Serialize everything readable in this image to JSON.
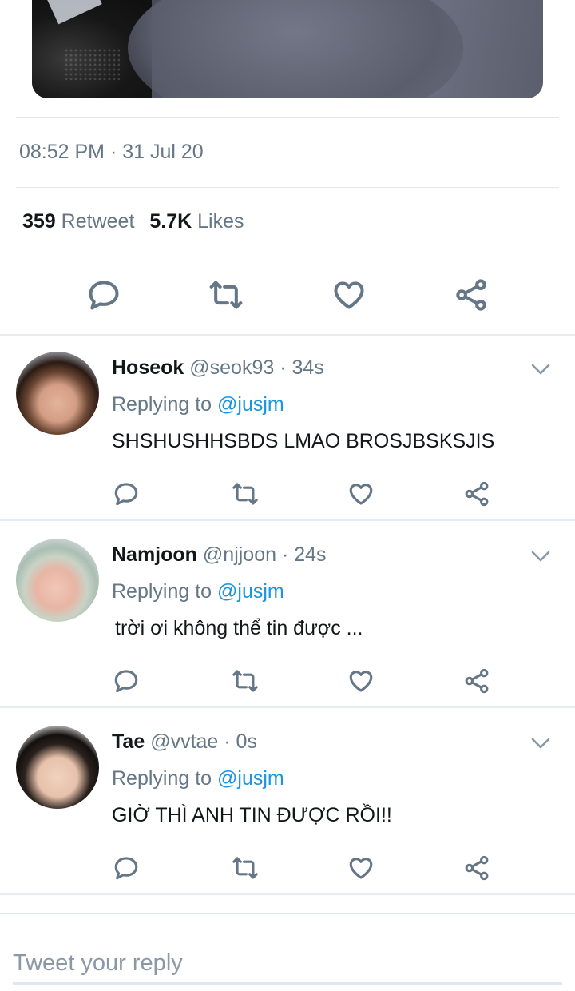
{
  "tweet": {
    "timestamp": "08:52 PM · 31 Jul 20",
    "retweet_count": "359",
    "retweet_label": "Retweet",
    "likes_count": "5.7K",
    "likes_label": "Likes"
  },
  "replies": [
    {
      "name": "Hoseok",
      "handle_time": "@seok93 · 34s",
      "replying_prefix": "Replying to",
      "mention": "@jusjm",
      "text": "SHSHUSHHSBDS LMAO BROSJBSKSJIS"
    },
    {
      "name": "Namjoon",
      "handle_time": "@njjoon · 24s",
      "replying_prefix": "Replying to",
      "mention": "@jusjm",
      "text": "trời ơi không thể tin được ..."
    },
    {
      "name": "Tae",
      "handle_time": "@vvtae · 0s",
      "replying_prefix": "Replying to",
      "mention": "@jusjm",
      "text": "GIỜ THÌ ANH TIN ĐƯỢC RỒI!!"
    }
  ],
  "composer": {
    "placeholder": "Tweet your reply"
  },
  "icons": {
    "reply": "reply-icon",
    "retweet": "retweet-icon",
    "like": "heart-icon",
    "share": "share-icon",
    "more": "chevron-down-icon"
  },
  "colors": {
    "secondary_text": "#657786",
    "mention": "#1b95e0",
    "divider": "#e1e8ed"
  }
}
